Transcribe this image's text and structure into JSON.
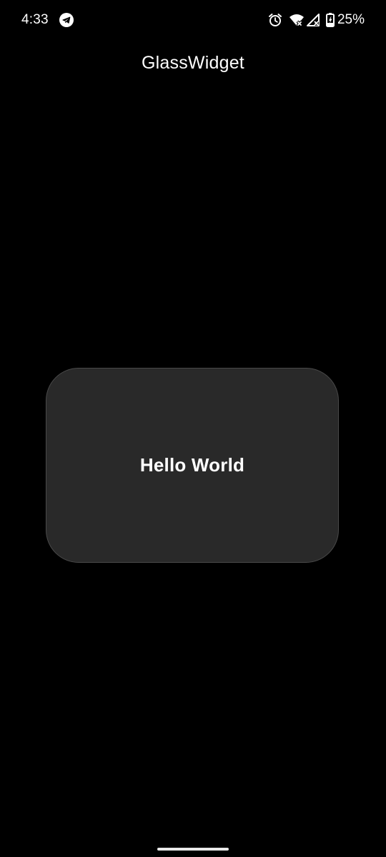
{
  "status_bar": {
    "time": "4:33",
    "battery_percent": "25%",
    "icons": [
      "telegram-icon",
      "alarm-icon",
      "wifi-off-icon",
      "signal-off-icon",
      "battery-charging-icon"
    ]
  },
  "app_bar": {
    "title": "GlassWidget"
  },
  "card": {
    "text": "Hello World"
  },
  "colors": {
    "background": "#000000",
    "card_fill": "#292929",
    "card_border": "#4a4a4a",
    "text": "#ffffff"
  }
}
